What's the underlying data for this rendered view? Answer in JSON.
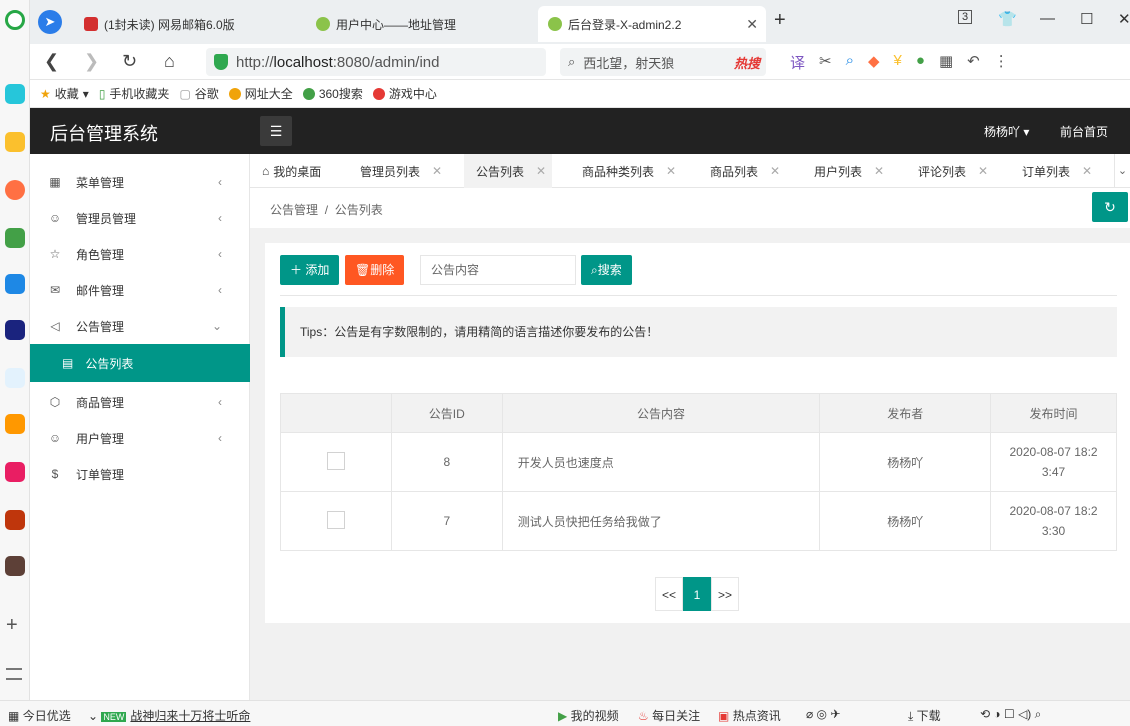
{
  "browser": {
    "tabs": [
      {
        "label": "(1封未读) 网易邮箱6.0版"
      },
      {
        "label": "用户中心——地址管理"
      },
      {
        "label": "后台登录-X-admin2.2"
      }
    ],
    "tab_count": "3",
    "url": {
      "prefix": "http://",
      "host": "localhost",
      "rest": ":8080/admin/ind"
    },
    "search": {
      "text": "西北望，射天狼",
      "hot": "热搜"
    },
    "bookmarks": [
      "收藏",
      "手机收藏夹",
      "谷歌",
      "网址大全",
      "360搜索",
      "游戏中心"
    ]
  },
  "app": {
    "title": "后台管理系统",
    "user": "杨杨吖",
    "front_page": "前台首页"
  },
  "sidebar": {
    "items": [
      {
        "label": "菜单管理",
        "icon": "grid-icon"
      },
      {
        "label": "管理员管理",
        "icon": "user-icon"
      },
      {
        "label": "角色管理",
        "icon": "star-icon"
      },
      {
        "label": "邮件管理",
        "icon": "mail-icon"
      },
      {
        "label": "公告管理",
        "icon": "speaker-icon"
      },
      {
        "label": "商品管理",
        "icon": "box-icon"
      },
      {
        "label": "用户管理",
        "icon": "user-icon"
      },
      {
        "label": "订单管理",
        "icon": "dollar-icon"
      }
    ],
    "sub_active": "公告列表"
  },
  "page_tabs": [
    "我的桌面",
    "管理员列表",
    "公告列表",
    "商品种类列表",
    "商品列表",
    "用户列表",
    "评论列表",
    "订单列表"
  ],
  "breadcrumb": {
    "parent": "公告管理",
    "separator": "/",
    "current": "公告列表"
  },
  "toolbar": {
    "add_label": "添加",
    "delete_label": "删除",
    "search_placeholder": "公告内容",
    "search_label": "搜索"
  },
  "tips": "Tips：公告是有字数限制的，请用精简的语言描述你要发布的公告！",
  "table": {
    "headers": [
      "",
      "公告ID",
      "公告内容",
      "发布者",
      "发布时间"
    ],
    "rows": [
      {
        "id": "8",
        "content": "开发人员也速度点",
        "publisher": "杨杨吖",
        "time_1": "2020-08-07 18:2",
        "time_2": "3:47"
      },
      {
        "id": "7",
        "content": "测试人员快把任务给我做了",
        "publisher": "杨杨吖",
        "time_1": "2020-08-07 18:2",
        "time_2": "3:30"
      }
    ]
  },
  "pager": {
    "prev": "<<",
    "current": "1",
    "next": ">>"
  },
  "statusbar": {
    "left": "今日优选",
    "news": "战神归来十万将士听命",
    "new_badge": "NEW",
    "my_video": "我的视频",
    "daily": "每日关注",
    "hot_news": "热点资讯",
    "download": "下载"
  },
  "colors": {
    "accent": "#009688",
    "danger": "#ff5722",
    "header": "#222222"
  }
}
